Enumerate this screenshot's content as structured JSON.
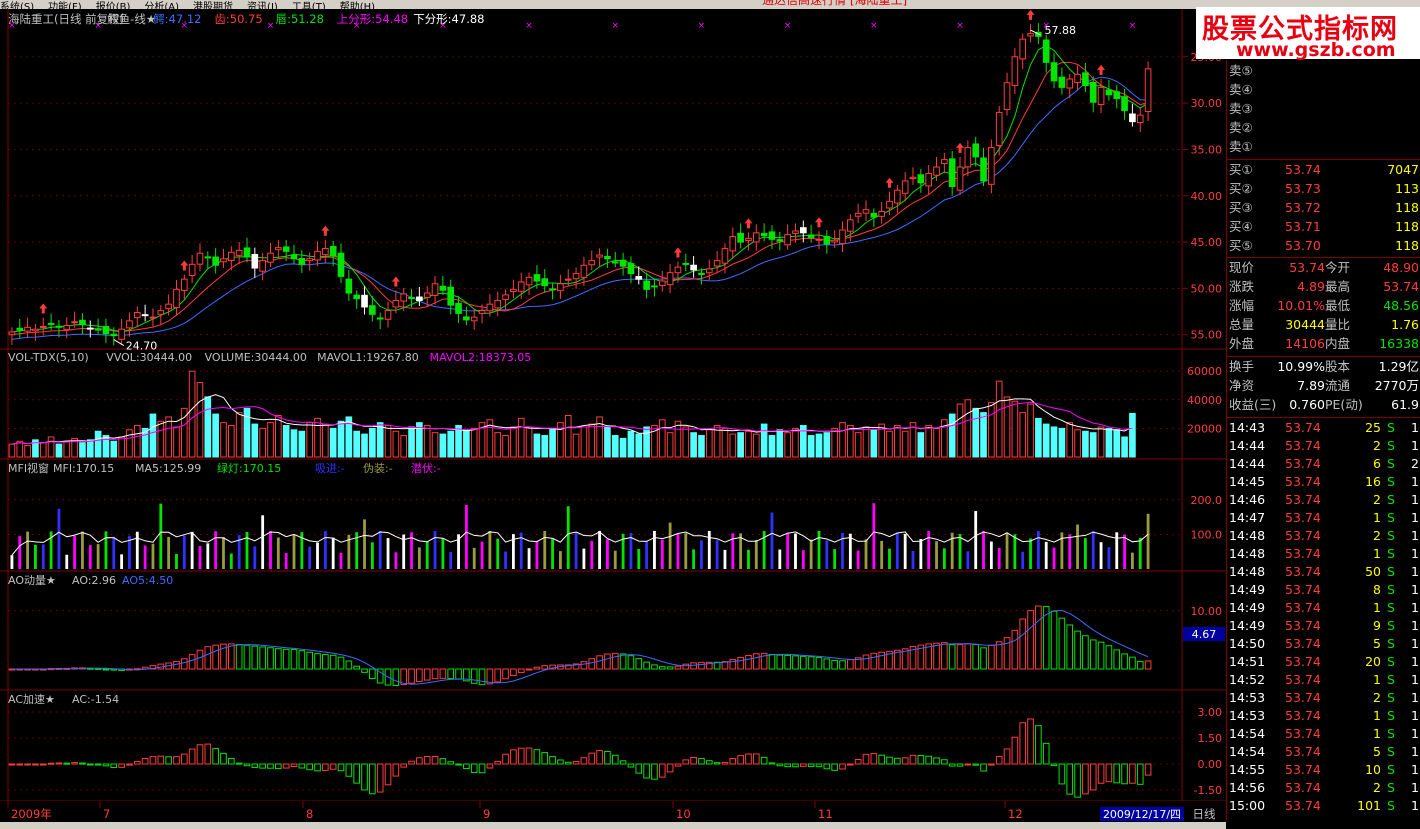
{
  "menu": {
    "items": [
      "系统(S)",
      "功能(F)",
      "报价(B)",
      "分析(A)",
      "港股期货",
      "资讯(I)",
      "工具(T)",
      "帮助(H)"
    ],
    "center_title": "通达信高速行情 [海陆重工]"
  },
  "watermark": {
    "line1": "股票公式指标网",
    "line2": "www.gszb.com"
  },
  "main_panel": {
    "stock": "海陆重工(日线 前复权)",
    "indicator": "鳄鱼-线★",
    "jaw_label": "鳄:47.12",
    "teeth_label": "齿:50.75",
    "lips_label": "唇:51.28",
    "up_fractal_label": "上分形:54.48",
    "down_fractal_label": "下分形:47.88",
    "high_marker": "57.88",
    "low_marker": "24.70",
    "yticks": [
      "55.00",
      "50.00",
      "45.00",
      "40.00",
      "35.00",
      "30.00",
      "25.00"
    ]
  },
  "vol_panel": {
    "name": "VOL-TDX(5,10)",
    "vvol": "VVOL:30444.00",
    "volume": "VOLUME:30444.00",
    "mavol1": "MAVOL1:19267.80",
    "mavol2": "MAVOL2:18373.05",
    "yticks": [
      "60000",
      "40000",
      "20000"
    ]
  },
  "mfi_panel": {
    "name": "MFI视窗",
    "mfi": "MFI:170.15",
    "ma5": "MA5:125.99",
    "green": "绿灯:170.15",
    "accum": "吸进:-",
    "fake": "伪装:-",
    "latent": "潜伏:-",
    "yticks": [
      "200.0",
      "100.0"
    ]
  },
  "ao_panel": {
    "name": "AO动量★",
    "ao": "AO:2.96",
    "ao5": "AO5:4.50",
    "ytick": "10.00",
    "current_badge": "4.67"
  },
  "ac_panel": {
    "name": "AC加速★",
    "ac": "AC:-1.54",
    "yticks": [
      "3.00",
      "1.50",
      "0.00",
      "-1.50"
    ]
  },
  "time_axis": {
    "labels": [
      "2009年",
      "7",
      "8",
      "9",
      "10",
      "11",
      "12"
    ],
    "current_date": "2009/12/17/四",
    "period": "日线"
  },
  "quote": {
    "asks": [
      {
        "label": "卖⑤",
        "price": "",
        "vol": ""
      },
      {
        "label": "卖④",
        "price": "",
        "vol": ""
      },
      {
        "label": "卖③",
        "price": "",
        "vol": ""
      },
      {
        "label": "卖②",
        "price": "",
        "vol": ""
      },
      {
        "label": "卖①",
        "price": "",
        "vol": ""
      }
    ],
    "bids": [
      {
        "label": "买①",
        "price": "53.74",
        "vol": "7047"
      },
      {
        "label": "买②",
        "price": "53.73",
        "vol": "113"
      },
      {
        "label": "买③",
        "price": "53.72",
        "vol": "118"
      },
      {
        "label": "买④",
        "price": "53.71",
        "vol": "118"
      },
      {
        "label": "买⑤",
        "price": "53.70",
        "vol": "118"
      }
    ],
    "stats": [
      {
        "l1": "现价",
        "v1": "53.74",
        "l2": "今开",
        "v2": "48.90",
        "c1": "#ff3c3c",
        "c2": "#ff3c3c"
      },
      {
        "l1": "涨跌",
        "v1": "4.89",
        "l2": "最高",
        "v2": "53.74",
        "c1": "#ff3c3c",
        "c2": "#ff3c3c"
      },
      {
        "l1": "涨幅",
        "v1": "10.01%",
        "l2": "最低",
        "v2": "48.56",
        "c1": "#ff3c3c",
        "c2": "#00e400"
      },
      {
        "l1": "总量",
        "v1": "30444",
        "l2": "量比",
        "v2": "1.76",
        "c1": "#ffff00",
        "c2": "#ffff00"
      },
      {
        "l1": "外盘",
        "v1": "14106",
        "l2": "内盘",
        "v2": "16338",
        "c1": "#ff3c3c",
        "c2": "#00e400"
      }
    ],
    "fundamentals": [
      {
        "l1": "换手",
        "v1": "10.99%",
        "l2": "股本",
        "v2": "1.29亿"
      },
      {
        "l1": "净资",
        "v1": "7.89",
        "l2": "流通",
        "v2": "2770万"
      },
      {
        "l1": "收益(三)",
        "v1": "0.760",
        "l2": "PE(动)",
        "v2": "61.9"
      }
    ],
    "ticks": [
      {
        "time": "14:43",
        "price": "53.74",
        "vol": "25",
        "side": "S",
        "n": "1"
      },
      {
        "time": "14:44",
        "price": "53.74",
        "vol": "2",
        "side": "S",
        "n": "1"
      },
      {
        "time": "14:44",
        "price": "53.74",
        "vol": "6",
        "side": "S",
        "n": "2"
      },
      {
        "time": "14:45",
        "price": "53.74",
        "vol": "16",
        "side": "S",
        "n": "1"
      },
      {
        "time": "14:46",
        "price": "53.74",
        "vol": "2",
        "side": "S",
        "n": "1"
      },
      {
        "time": "14:47",
        "price": "53.74",
        "vol": "1",
        "side": "S",
        "n": "1"
      },
      {
        "time": "14:48",
        "price": "53.74",
        "vol": "2",
        "side": "S",
        "n": "1"
      },
      {
        "time": "14:48",
        "price": "53.74",
        "vol": "1",
        "side": "S",
        "n": "1"
      },
      {
        "time": "14:48",
        "price": "53.74",
        "vol": "50",
        "side": "S",
        "n": "1"
      },
      {
        "time": "14:49",
        "price": "53.74",
        "vol": "8",
        "side": "S",
        "n": "1"
      },
      {
        "time": "14:49",
        "price": "53.74",
        "vol": "1",
        "side": "S",
        "n": "1"
      },
      {
        "time": "14:49",
        "price": "53.74",
        "vol": "9",
        "side": "S",
        "n": "1"
      },
      {
        "time": "14:50",
        "price": "53.74",
        "vol": "5",
        "side": "S",
        "n": "1"
      },
      {
        "time": "14:51",
        "price": "53.74",
        "vol": "20",
        "side": "S",
        "n": "1"
      },
      {
        "time": "14:52",
        "price": "53.74",
        "vol": "1",
        "side": "S",
        "n": "1"
      },
      {
        "time": "14:53",
        "price": "53.74",
        "vol": "2",
        "side": "S",
        "n": "1"
      },
      {
        "time": "14:53",
        "price": "53.74",
        "vol": "1",
        "side": "S",
        "n": "1"
      },
      {
        "time": "14:54",
        "price": "53.74",
        "vol": "1",
        "side": "S",
        "n": "1"
      },
      {
        "time": "14:54",
        "price": "53.74",
        "vol": "5",
        "side": "S",
        "n": "1"
      },
      {
        "time": "14:55",
        "price": "53.74",
        "vol": "10",
        "side": "S",
        "n": "1"
      },
      {
        "time": "14:56",
        "price": "53.74",
        "vol": "2",
        "side": "S",
        "n": "1"
      },
      {
        "time": "15:00",
        "price": "53.74",
        "vol": "101",
        "side": "S",
        "n": "1"
      }
    ]
  },
  "colors": {
    "up": "#ff3c3c",
    "down": "#00e400",
    "grid": "#800000",
    "jaw": "#3d6cff",
    "teeth": "#ff3c3c",
    "lips": "#00e400",
    "purple": "#ff00ff",
    "cyan": "#54ffff",
    "yellow": "#ffff00"
  },
  "chart_data": [
    {
      "type": "candlestick",
      "title": "海陆重工(日线 前复权)",
      "x_range": [
        "2009-06",
        "2009-12-17"
      ],
      "ylim": [
        24,
        58
      ],
      "yticks": [
        25,
        30,
        35,
        40,
        45,
        50,
        55
      ],
      "close": [
        25.3,
        25.5,
        25.8,
        25.6,
        25.9,
        26.2,
        25.8,
        26.0,
        26.4,
        26.1,
        25.7,
        25.5,
        25.1,
        24.9,
        25.6,
        26.5,
        27.4,
        27.1,
        26.9,
        27.6,
        28.3,
        29.9,
        31.0,
        32.6,
        33.8,
        33.3,
        32.5,
        33.2,
        33.9,
        34.1,
        33.4,
        32.2,
        33.0,
        33.8,
        34.4,
        34.0,
        33.2,
        32.6,
        33.2,
        34.0,
        34.3,
        33.5,
        31.3,
        29.5,
        28.9,
        28.0,
        27.2,
        26.7,
        27.6,
        28.7,
        29.4,
        28.9,
        28.7,
        29.5,
        30.5,
        29.8,
        28.2,
        27.3,
        26.6,
        26.9,
        27.6,
        28.3,
        28.7,
        29.3,
        29.9,
        30.7,
        31.2,
        30.8,
        30.3,
        29.9,
        30.5,
        31.0,
        31.6,
        32.5,
        33.0,
        33.6,
        33.2,
        32.8,
        32.4,
        31.6,
        31.0,
        29.9,
        30.2,
        30.8,
        31.7,
        32.3,
        32.6,
        32.0,
        31.5,
        32.1,
        33.0,
        34.3,
        35.6,
        35.0,
        35.4,
        36.0,
        35.7,
        35.3,
        35.1,
        35.8,
        36.2,
        36.0,
        35.5,
        35.3,
        34.8,
        35.2,
        36.3,
        37.4,
        38.1,
        38.5,
        37.7,
        38.3,
        39.4,
        40.6,
        41.6,
        42.0,
        41.4,
        42.4,
        43.1,
        43.9,
        41.0,
        43.1,
        45.2,
        44.2,
        41.6,
        45.2,
        49.0,
        52.2,
        55.0,
        56.9,
        57.5,
        57.2,
        54.4,
        52.4,
        51.7,
        52.6,
        53.1,
        51.9,
        50.1,
        51.7,
        50.9,
        50.5,
        49.2,
        48.0,
        48.7,
        53.7
      ],
      "high_point": 57.88,
      "low_point": 24.7,
      "lines": [
        {
          "name": "鳄",
          "last": 47.12
        },
        {
          "name": "齿",
          "last": 50.75
        },
        {
          "name": "唇",
          "last": 51.28
        }
      ]
    },
    {
      "type": "bar",
      "title": "VOL-TDX(5,10)",
      "ylim": [
        0,
        65000
      ],
      "values": [
        9000,
        11000,
        8000,
        12000,
        10000,
        14000,
        9000,
        11000,
        13000,
        10000,
        12000,
        18000,
        15000,
        11000,
        14000,
        19000,
        22000,
        20000,
        30000,
        25000,
        28000,
        21000,
        34000,
        60000,
        52000,
        42000,
        30000,
        24000,
        22000,
        31000,
        34000,
        23000,
        20000,
        24000,
        29000,
        22000,
        19000,
        18000,
        24000,
        27000,
        23000,
        20000,
        25000,
        28000,
        18000,
        16000,
        20000,
        24000,
        22000,
        18000,
        15000,
        21000,
        24000,
        22000,
        17000,
        16000,
        18000,
        22000,
        19000,
        20000,
        24000,
        26000,
        17000,
        15000,
        21000,
        27000,
        21000,
        16000,
        15000,
        20000,
        24000,
        29000,
        16000,
        21000,
        23000,
        28000,
        21000,
        15000,
        13000,
        18000,
        16000,
        21000,
        22000,
        26000,
        17000,
        25000,
        21000,
        17000,
        15000,
        19000,
        22000,
        20000,
        16000,
        17000,
        18000,
        16000,
        23000,
        15000,
        19000,
        17000,
        20000,
        22000,
        15000,
        16000,
        17000,
        20000,
        24000,
        22000,
        17000,
        21000,
        19000,
        23000,
        18000,
        22000,
        18000,
        24000,
        17000,
        22000,
        20000,
        26000,
        30000,
        37000,
        40000,
        34000,
        31000,
        38000,
        53000,
        42000,
        39000,
        31000,
        37000,
        27000,
        23000,
        21000,
        20000,
        24000,
        19000,
        18000,
        17000,
        21000,
        20000,
        19000,
        14000,
        30444
      ],
      "mavol1_last": 19267.8,
      "mavol2_last": 18373.05
    }
  ]
}
